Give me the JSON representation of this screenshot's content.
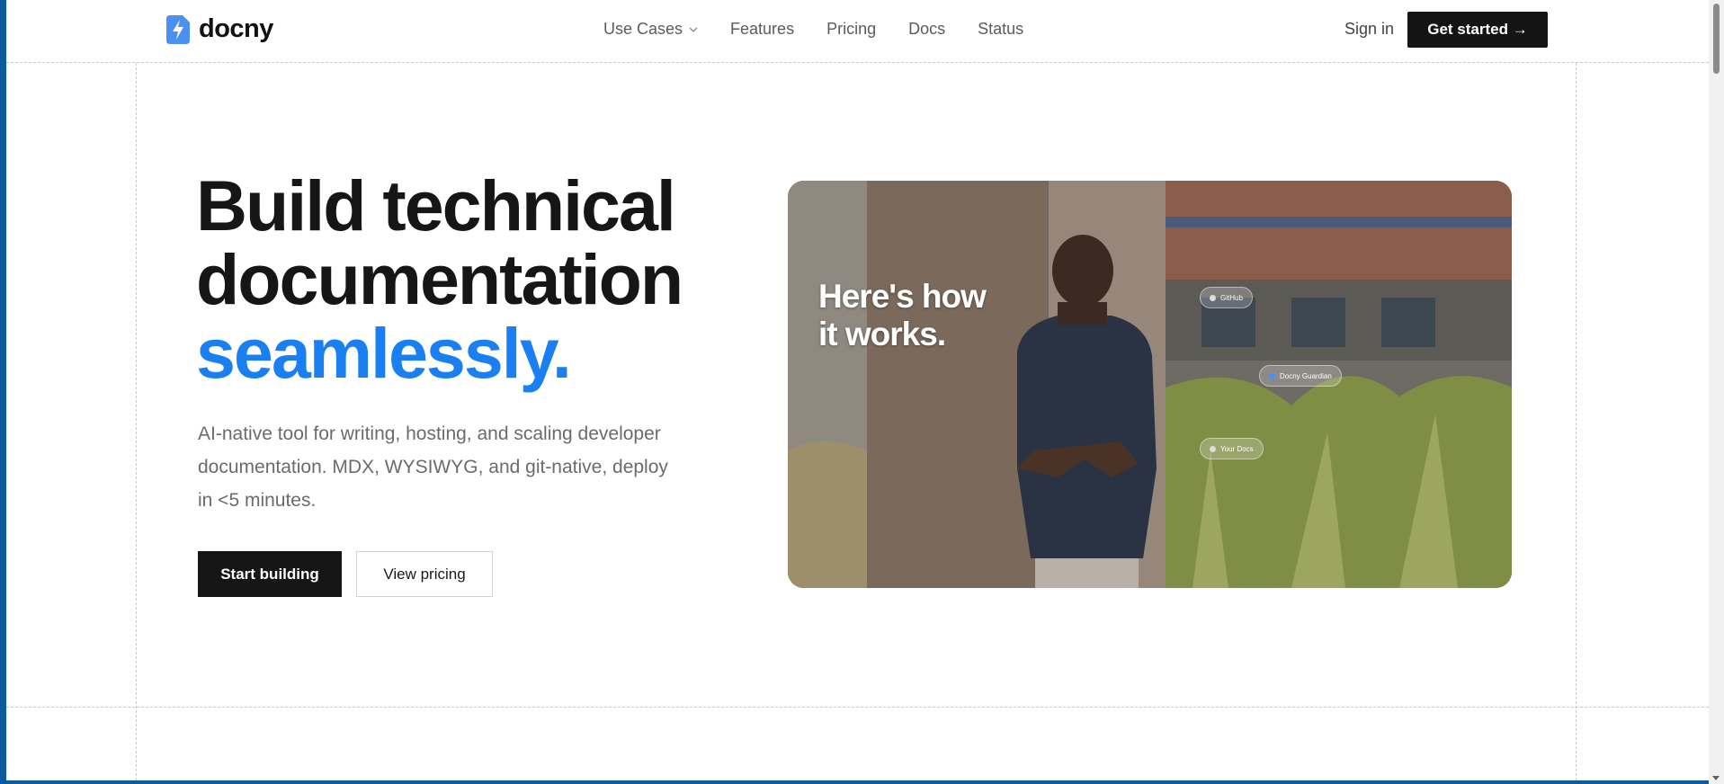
{
  "brand": {
    "name": "docny",
    "accent": "#1a7ff0"
  },
  "nav": {
    "items": [
      {
        "label": "Use Cases",
        "has_dropdown": true
      },
      {
        "label": "Features"
      },
      {
        "label": "Pricing"
      },
      {
        "label": "Docs"
      },
      {
        "label": "Status"
      }
    ],
    "sign_in": "Sign in",
    "cta": "Get started →"
  },
  "hero": {
    "headline_line1": "Build technical",
    "headline_line2": "documentation",
    "headline_accent": "seamlessly.",
    "subtext": "AI-native tool for writing, hosting, and scaling developer documentation. MDX, WYSIWYG, and git-native, deploy in <5 minutes.",
    "primary_button": "Start building",
    "secondary_button": "View pricing"
  },
  "video": {
    "title_line1": "Here's how",
    "title_line2": "it works.",
    "chips": [
      "GitHub",
      "Docny Guardian",
      "Your Docs"
    ]
  }
}
